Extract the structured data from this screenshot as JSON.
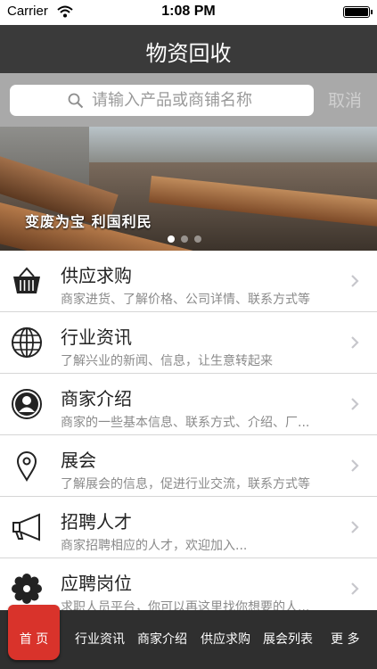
{
  "status_bar": {
    "carrier": "Carrier",
    "time": "1:08 PM"
  },
  "navbar": {
    "title": "物资回收"
  },
  "search": {
    "placeholder": "请输入产品或商铺名称",
    "cancel": "取消"
  },
  "banner": {
    "slogan": "变废为宝  利国利民",
    "page_index": 1,
    "page_count": 3
  },
  "menu": [
    {
      "title": "供应求购",
      "subtitle": "商家进货、了解价格、公司详情、联系方式等",
      "icon": "basket-icon"
    },
    {
      "title": "行业资讯",
      "subtitle": "了解兴业的新闻、信息，让生意转起来",
      "icon": "globe-icon"
    },
    {
      "title": "商家介绍",
      "subtitle": "商家的一些基本信息、联系方式、介绍、厂...",
      "icon": "person-icon"
    },
    {
      "title": "展会",
      "subtitle": "了解展会的信息，促进行业交流，联系方式等",
      "icon": "location-pin-icon"
    },
    {
      "title": "招聘人才",
      "subtitle": "商家招聘相应的人才，欢迎加入...",
      "icon": "megaphone-icon"
    },
    {
      "title": "应聘岗位",
      "subtitle": "求职人员平台，你可以再这里找你想要的人...",
      "icon": "gear-icon"
    }
  ],
  "tabbar": {
    "home": "首 页",
    "tabs": [
      "行业资讯",
      "商家介绍",
      "供应求购",
      "展会列表",
      "更  多"
    ]
  },
  "colors": {
    "navbar": "#3a3a3a",
    "search_bar": "#a9a9a9",
    "tabbar": "#2f2f2f",
    "home_tab": "#d9332b"
  }
}
